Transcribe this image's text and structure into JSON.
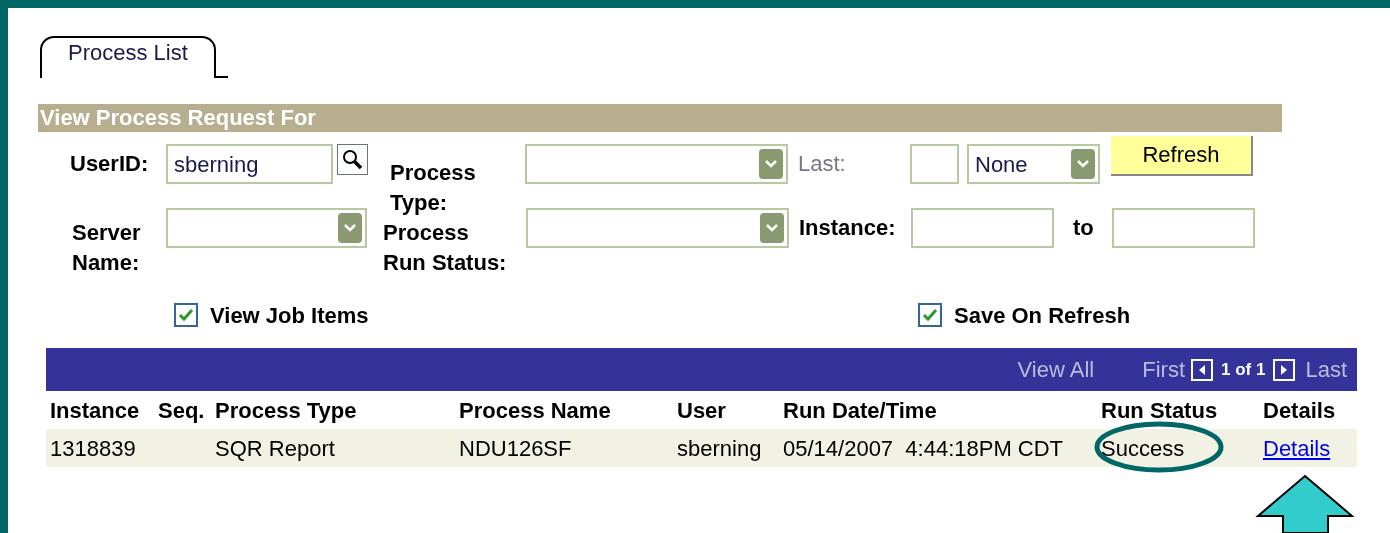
{
  "tab": {
    "label": "Process List",
    "selected": true
  },
  "section_title": "View Process Request For",
  "fields": {
    "user_id": {
      "label": "UserID:",
      "value": "sberning"
    },
    "process_type": {
      "label": "Process Type:"
    },
    "last": {
      "label": "Last:",
      "disabled": true,
      "unit": "None"
    },
    "refresh": "Refresh",
    "server_name": {
      "label": "Server Name:"
    },
    "run_status": {
      "label": "Process Run Status:"
    },
    "instance": {
      "label": "Instance:",
      "to": "to"
    }
  },
  "checkboxes": [
    {
      "label": "View Job Items",
      "checked": true
    },
    {
      "label": "Save On Refresh",
      "checked": true
    }
  ],
  "pager": {
    "view_all": "View All",
    "first": "First",
    "count": "1 of 1",
    "last": "Last"
  },
  "table": {
    "columns": [
      "Instance",
      "Seq.",
      "Process Type",
      "Process Name",
      "User",
      "Run Date/Time",
      "Run Status",
      "Details"
    ],
    "rows": [
      {
        "cells": [
          "1318839",
          "",
          "SQR Report",
          "NDU126SF",
          "sberning",
          "05/14/2007  4:44:18PM CDT",
          "Success"
        ],
        "link": "Details"
      }
    ]
  }
}
